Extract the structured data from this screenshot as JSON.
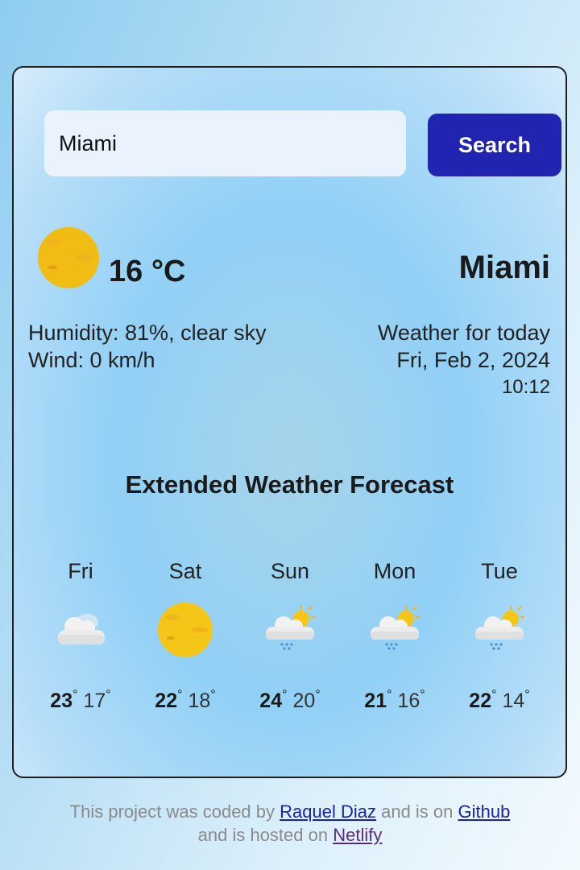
{
  "search": {
    "value": "Miami",
    "button_label": "Search"
  },
  "current": {
    "temperature": "16",
    "unit": "°C",
    "icon": "sun-icon",
    "city": "Miami",
    "humidity_line": "Humidity: 81%, clear sky",
    "wind_line": "Wind: 0 km/h",
    "weather_label": "Weather for today",
    "date": "Fri, Feb 2, 2024",
    "time": "10:12"
  },
  "forecast": {
    "title": "Extended Weather Forecast",
    "days": [
      {
        "day": "Fri",
        "icon": "cloud-icon",
        "max": "23",
        "min": "17"
      },
      {
        "day": "Sat",
        "icon": "sun-icon",
        "max": "22",
        "min": "18"
      },
      {
        "day": "Sun",
        "icon": "rain-sun-icon",
        "max": "24",
        "min": "20"
      },
      {
        "day": "Mon",
        "icon": "rain-sun-icon",
        "max": "21",
        "min": "16"
      },
      {
        "day": "Tue",
        "icon": "rain-sun-icon",
        "max": "22",
        "min": "14"
      }
    ]
  },
  "footer": {
    "text1": "This project was coded by ",
    "author_link": "Raquel Diaz",
    "text2": " and is on ",
    "github_link": "Github",
    "text3": "and is hosted on ",
    "netlify_link": "Netlify"
  },
  "colors": {
    "button": "#2024b0",
    "sun": "#f5c518",
    "link": "#1a22a6"
  }
}
